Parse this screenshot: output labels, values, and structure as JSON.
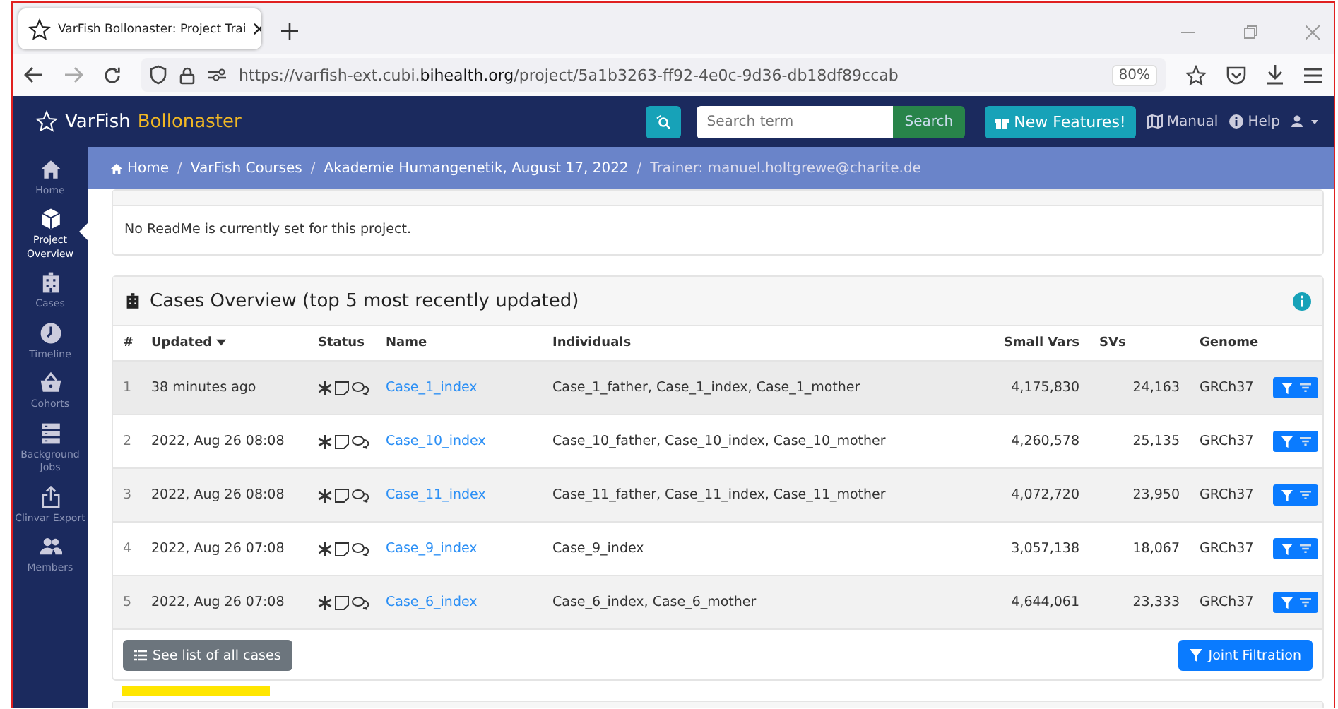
{
  "browser": {
    "tab_title": "VarFish Bollonaster: Project Trai",
    "url": "https://varfish-ext.cubi.**bihealth.org**/project/5a1b3263-ff92-4e0c-9d36-db18df89ccab",
    "zoom": "80%"
  },
  "navbar": {
    "brand": "VarFish",
    "brand_suffix": "Bollonaster",
    "search": {
      "placeholder": "Search term"
    },
    "search_button": "Search",
    "new_features": "New Features!",
    "manual": "Manual",
    "help": "Help"
  },
  "sidebar": {
    "items": [
      {
        "kind": "home",
        "label": "Home",
        "selected": false
      },
      {
        "kind": "project",
        "label": "Project Overview",
        "selected": true
      },
      {
        "kind": "cases",
        "label": "Cases",
        "selected": false
      },
      {
        "kind": "timeline",
        "label": "Timeline",
        "selected": false
      },
      {
        "kind": "cohorts",
        "label": "Cohorts",
        "selected": false
      },
      {
        "kind": "jobs",
        "label": "Background Jobs",
        "selected": false
      },
      {
        "kind": "export",
        "label": "Clinvar Export",
        "selected": false
      },
      {
        "kind": "members",
        "label": "Members",
        "selected": false
      }
    ]
  },
  "breadcrumb_separator": "/",
  "breadcrumb": [
    "Home",
    "VarFish Courses",
    "Akademie Humangenetik, August 17, 2022",
    "Trainer: manuel.holtgrewe@charite.de"
  ],
  "readme": {
    "text": "No ReadMe is currently set for this project."
  },
  "cases": {
    "title": "Cases Overview (top 5 most recently updated)",
    "columns": [
      "#",
      "Updated",
      "Status",
      "Name",
      "Individuals",
      "Small Vars",
      "SVs",
      "Genome"
    ],
    "rows": [
      {
        "index": "1",
        "updated": "38 minutes ago",
        "name": "Case_1_index",
        "individuals": "Case_1_father, Case_1_index, Case_1_mother",
        "small_vars": "4,175,830",
        "svs": "24,163",
        "genome": "GRCh37"
      },
      {
        "index": "2",
        "updated": "2022, Aug 26 08:08",
        "name": "Case_10_index",
        "individuals": "Case_10_father, Case_10_index, Case_10_mother",
        "small_vars": "4,260,578",
        "svs": "25,135",
        "genome": "GRCh37"
      },
      {
        "index": "3",
        "updated": "2022, Aug 26 08:08",
        "name": "Case_11_index",
        "individuals": "Case_11_father, Case_11_index, Case_11_mother",
        "small_vars": "4,072,720",
        "svs": "23,950",
        "genome": "GRCh37"
      },
      {
        "index": "4",
        "updated": "2022, Aug 26 07:08",
        "name": "Case_9_index",
        "individuals": "Case_9_index",
        "small_vars": "3,057,138",
        "svs": "18,067",
        "genome": "GRCh37"
      },
      {
        "index": "5",
        "updated": "2022, Aug 26 07:08",
        "name": "Case_6_index",
        "individuals": "Case_6_index, Case_6_mother",
        "small_vars": "4,644,061",
        "svs": "23,333",
        "genome": "GRCh37"
      }
    ],
    "all_cases_button": "See list of all cases",
    "joint_button": "Joint Filtration"
  }
}
